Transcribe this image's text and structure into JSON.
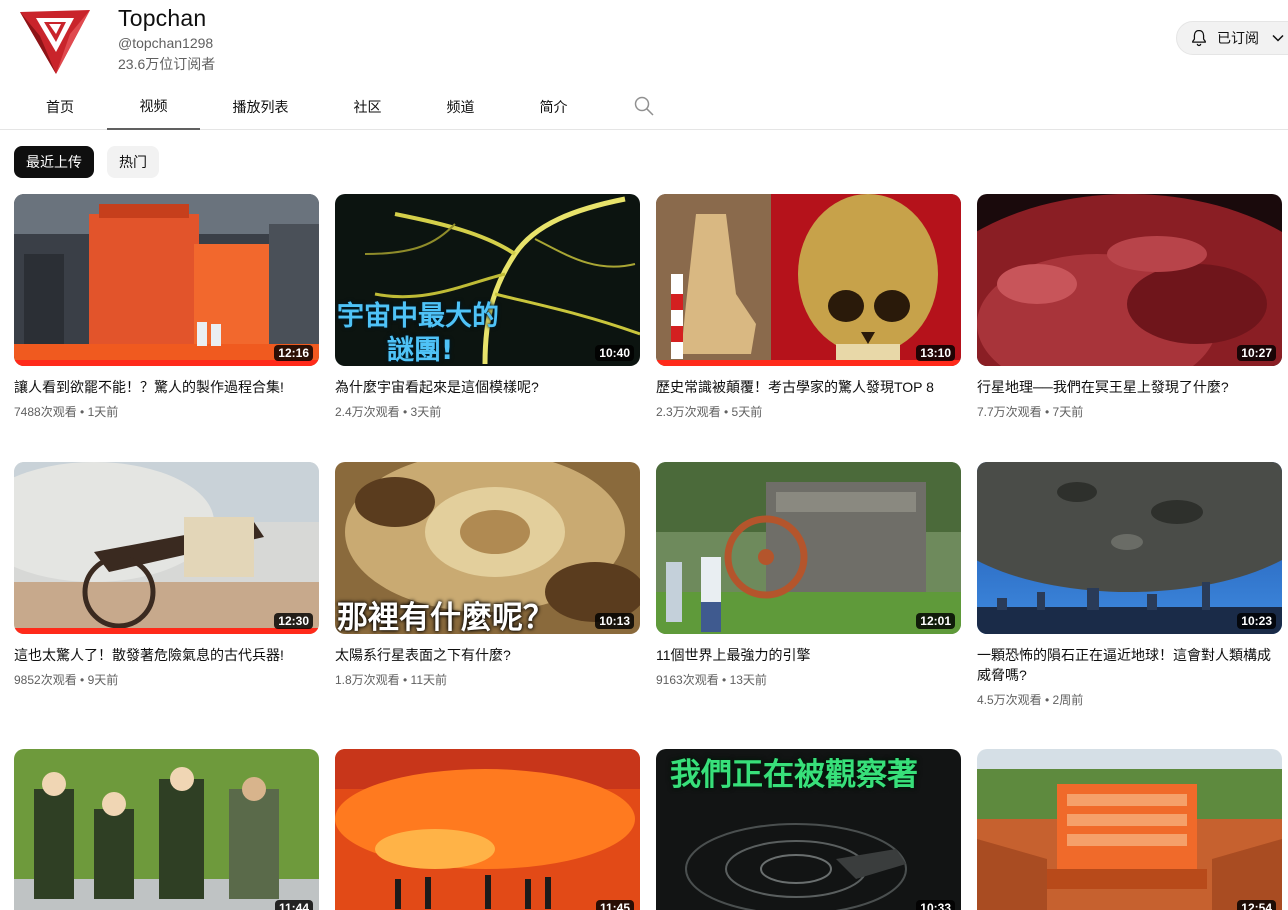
{
  "channel": {
    "name": "Topchan",
    "handle": "@topchan1298",
    "subscribers": "23.6万位订阅者",
    "subscribe_label": "已订阅"
  },
  "tabs": [
    {
      "label": "首页"
    },
    {
      "label": "视频"
    },
    {
      "label": "播放列表"
    },
    {
      "label": "社区"
    },
    {
      "label": "频道"
    },
    {
      "label": "简介"
    }
  ],
  "chips": [
    {
      "label": "最近上传"
    },
    {
      "label": "热门"
    }
  ],
  "videos": [
    {
      "title": "讓人看到欲罷不能！？驚人的製作過程合集!",
      "meta": "7488次观看 • 1天前",
      "duration": "12:16"
    },
    {
      "title": "為什麼宇宙看起來是這個模樣呢?",
      "meta": "2.4万次观看 • 3天前",
      "duration": "10:40",
      "thumb_text": [
        "宇宙中最大的",
        "謎團!"
      ]
    },
    {
      "title": "歷史常識被顛覆！考古學家的驚人發現TOP 8",
      "meta": "2.3万次观看 • 5天前",
      "duration": "13:10"
    },
    {
      "title": "行星地理──我們在冥王星上發現了什麼?",
      "meta": "7.7万次观看 • 7天前",
      "duration": "10:27"
    },
    {
      "title": "這也太驚人了！散發著危險氣息的古代兵器!",
      "meta": "9852次观看 • 9天前",
      "duration": "12:30"
    },
    {
      "title": "太陽系行星表面之下有什麼?",
      "meta": "1.8万次观看 • 11天前",
      "duration": "10:13",
      "thumb_text": [
        "那裡有什麼呢？"
      ]
    },
    {
      "title": "11個世界上最強力的引擎",
      "meta": "9163次观看 • 13天前",
      "duration": "12:01"
    },
    {
      "title": "一顆恐怖的隕石正在逼近地球！這會對人類構成威脅嗎?",
      "meta": "4.5万次观看 • 2周前",
      "duration": "10:23"
    },
    {
      "title": "",
      "meta": "",
      "duration": "11:44"
    },
    {
      "title": "",
      "meta": "",
      "duration": "11:45"
    },
    {
      "title": "",
      "meta": "",
      "duration": "10:33",
      "thumb_text": [
        "我們正在被觀察著"
      ]
    },
    {
      "title": "",
      "meta": "",
      "duration": "12:54"
    }
  ]
}
